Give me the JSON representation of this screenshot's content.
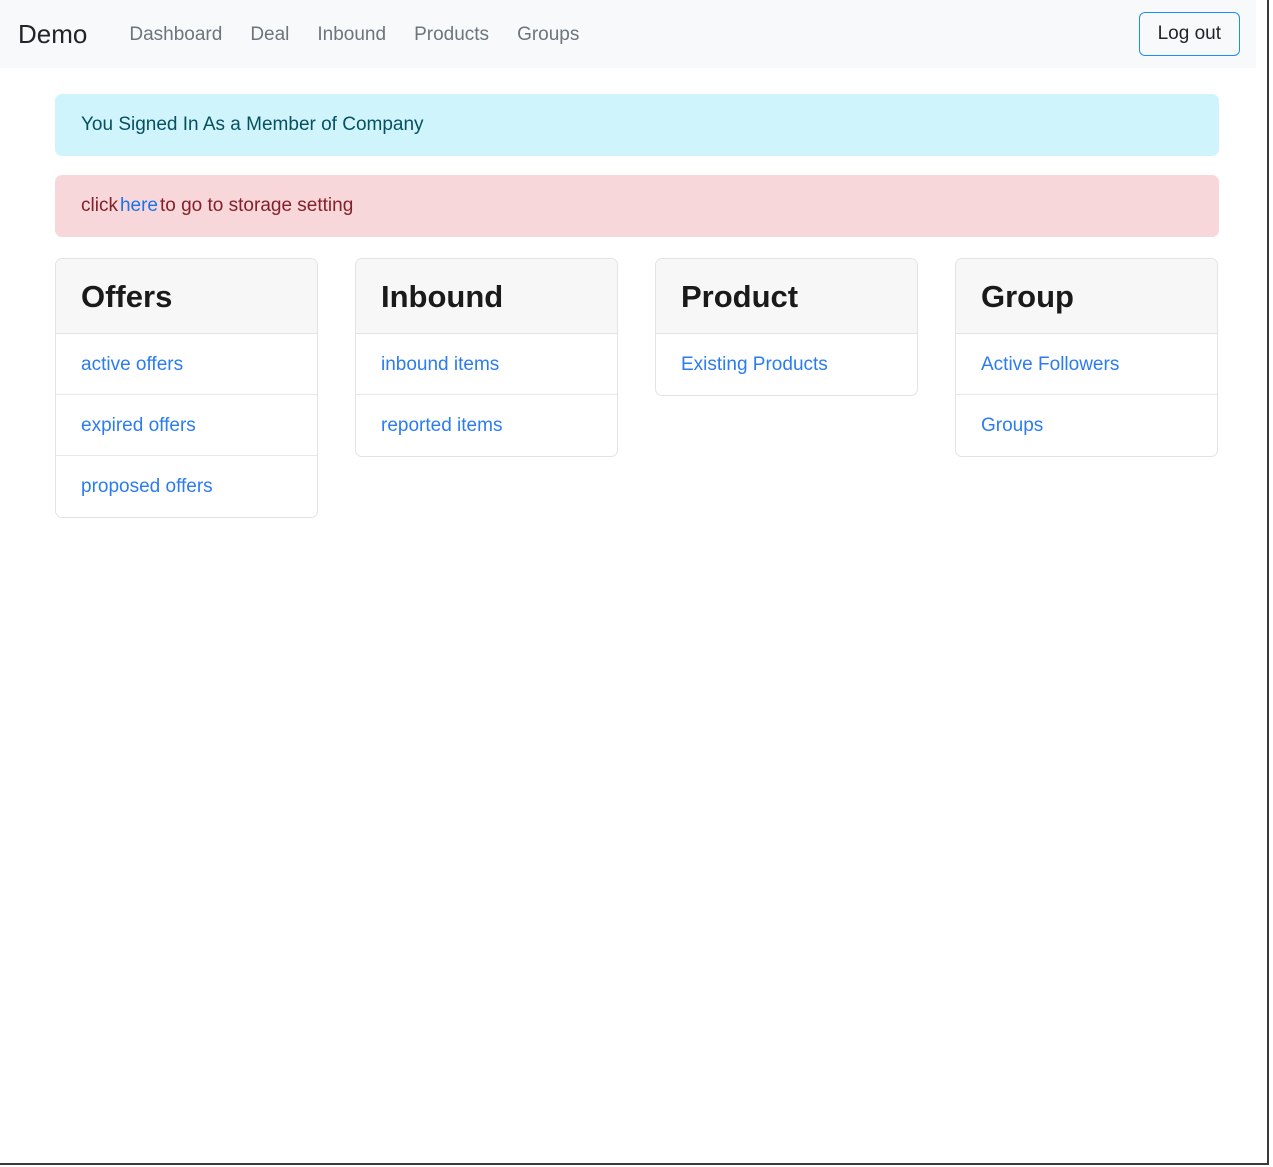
{
  "navbar": {
    "brand": "Demo",
    "links": [
      {
        "label": "Dashboard",
        "name": "nav-link-dashboard"
      },
      {
        "label": "Deal",
        "name": "nav-link-deal"
      },
      {
        "label": "Inbound",
        "name": "nav-link-inbound"
      },
      {
        "label": "Products",
        "name": "nav-link-products"
      },
      {
        "label": "Groups",
        "name": "nav-link-groups"
      }
    ],
    "logout_label": "Log out"
  },
  "alerts": {
    "info": {
      "text": "You Signed In As a Member of Company",
      "bg": "#cff4fc",
      "color": "#055160"
    },
    "danger": {
      "prefix": "click ",
      "link": "here",
      "suffix": " to go to storage setting",
      "bg": "#f8d7da",
      "color": "#842029",
      "link_color": "#1a73e8"
    }
  },
  "cards": [
    {
      "title": "Offers",
      "items": [
        {
          "label": "active offers"
        },
        {
          "label": "expired offers"
        },
        {
          "label": "proposed offers"
        }
      ]
    },
    {
      "title": "Inbound",
      "items": [
        {
          "label": "inbound items"
        },
        {
          "label": "reported items"
        }
      ]
    },
    {
      "title": "Product",
      "items": [
        {
          "label": "Existing Products"
        }
      ]
    },
    {
      "title": "Group",
      "items": [
        {
          "label": "Active Followers"
        },
        {
          "label": "Groups"
        }
      ]
    }
  ]
}
